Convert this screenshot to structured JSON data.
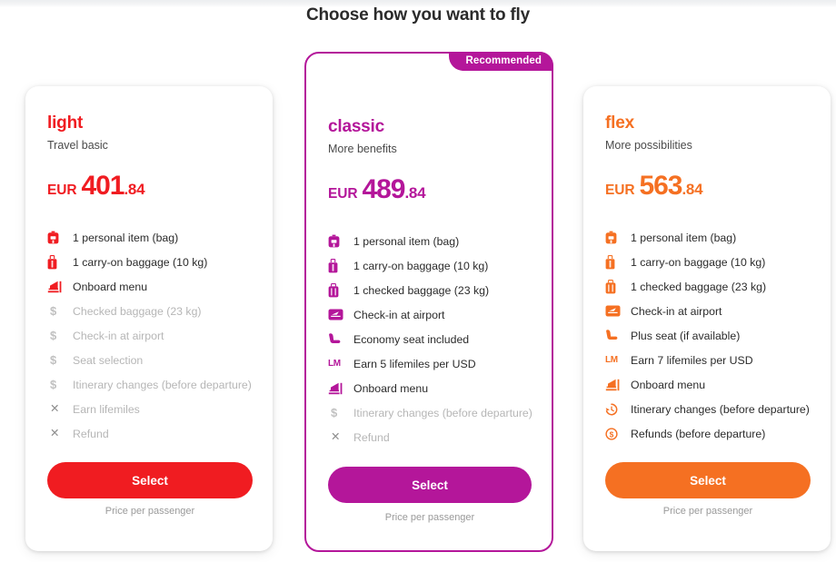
{
  "header": {
    "title": "Choose how you want to fly"
  },
  "colors": {
    "light": "#f01c21",
    "classic": "#b4169a",
    "flex": "#f57022",
    "muted": "#b6b6b6",
    "text": "#2b2b2b"
  },
  "badge": {
    "label": "Recommended"
  },
  "common": {
    "select_label": "Select",
    "per_passenger_label": "Price per passenger",
    "currency": "EUR"
  },
  "cards": [
    {
      "id": "light",
      "name": "light",
      "tagline": "Travel basic",
      "currency": "EUR",
      "price_int": "401",
      "price_dec": ".84",
      "accent": "#f01c21",
      "select_label": "Select",
      "per_passenger_label": "Price per passenger",
      "features": [
        {
          "icon": "backpack-icon",
          "label": "1 personal item (bag)",
          "included": true
        },
        {
          "icon": "carryon-bag-icon",
          "label": "1 carry-on baggage (10 kg)",
          "included": true
        },
        {
          "icon": "onboard-menu-icon",
          "label": "Onboard menu",
          "included": true
        },
        {
          "icon": "dollar-icon",
          "label": "Checked baggage (23 kg)",
          "included": false
        },
        {
          "icon": "dollar-icon",
          "label": "Check-in at airport",
          "included": false
        },
        {
          "icon": "dollar-icon",
          "label": "Seat selection",
          "included": false
        },
        {
          "icon": "dollar-icon",
          "label": "Itinerary changes (before departure)",
          "included": false
        },
        {
          "icon": "cross-icon",
          "label": "Earn lifemiles",
          "included": false
        },
        {
          "icon": "cross-icon",
          "label": "Refund",
          "included": false
        }
      ]
    },
    {
      "id": "classic",
      "name": "classic",
      "tagline": "More benefits",
      "currency": "EUR",
      "price_int": "489",
      "price_dec": ".84",
      "accent": "#b4169a",
      "select_label": "Select",
      "per_passenger_label": "Price per passenger",
      "recommended": true,
      "features": [
        {
          "icon": "backpack-icon",
          "label": "1 personal item (bag)",
          "included": true
        },
        {
          "icon": "carryon-bag-icon",
          "label": "1 carry-on baggage (10 kg)",
          "included": true
        },
        {
          "icon": "checked-bag-icon",
          "label": "1 checked baggage (23 kg)",
          "included": true
        },
        {
          "icon": "checkin-icon",
          "label": "Check-in at airport",
          "included": true
        },
        {
          "icon": "seat-icon",
          "label": "Economy seat included",
          "included": true
        },
        {
          "icon": "lifemiles-icon",
          "label": "Earn 5 lifemiles per USD",
          "included": true
        },
        {
          "icon": "onboard-menu-icon",
          "label": "Onboard menu",
          "included": true
        },
        {
          "icon": "dollar-icon",
          "label": "Itinerary changes (before departure)",
          "included": false
        },
        {
          "icon": "cross-icon",
          "label": "Refund",
          "included": false
        }
      ]
    },
    {
      "id": "flex",
      "name": "flex",
      "tagline": "More possibilities",
      "currency": "EUR",
      "price_int": "563",
      "price_dec": ".84",
      "accent": "#f57022",
      "select_label": "Select",
      "per_passenger_label": "Price per passenger",
      "features": [
        {
          "icon": "backpack-icon",
          "label": "1 personal item (bag)",
          "included": true
        },
        {
          "icon": "carryon-bag-icon",
          "label": "1 carry-on baggage (10 kg)",
          "included": true
        },
        {
          "icon": "checked-bag-icon",
          "label": "1 checked baggage (23 kg)",
          "included": true
        },
        {
          "icon": "checkin-icon",
          "label": "Check-in at airport",
          "included": true
        },
        {
          "icon": "seat-icon",
          "label": "Plus seat (if available)",
          "included": true
        },
        {
          "icon": "lifemiles-icon",
          "label": "Earn 7 lifemiles per USD",
          "included": true
        },
        {
          "icon": "onboard-menu-icon",
          "label": "Onboard menu",
          "included": true
        },
        {
          "icon": "clock-rewind-icon",
          "label": "Itinerary changes (before departure)",
          "included": true
        },
        {
          "icon": "refund-icon",
          "label": "Refunds (before departure)",
          "included": true
        }
      ]
    }
  ]
}
